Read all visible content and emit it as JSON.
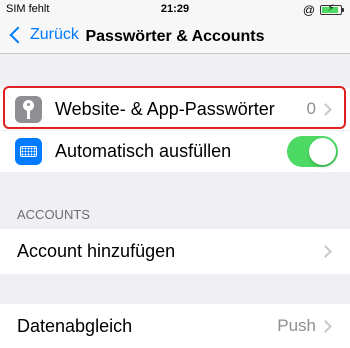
{
  "status_bar": {
    "carrier": "SIM fehlt",
    "time": "21:29",
    "icons": [
      "rotation-lock-icon",
      "battery-icon"
    ],
    "battery_color": "#4cd964",
    "battery_level": 0.9
  },
  "nav": {
    "back_label": "Zurück",
    "title": "Passwörter & Accounts"
  },
  "rows": {
    "passwords": {
      "label": "Website- & App-Passwörter",
      "value": "0",
      "icon": "key-icon"
    },
    "autofill": {
      "label": "Automatisch ausfüllen",
      "toggle_on": true,
      "icon": "keyboard-icon"
    },
    "add_account": {
      "label": "Account hinzufügen"
    },
    "fetch": {
      "label": "Datenabgleich",
      "value": "Push"
    }
  },
  "sections": {
    "accounts_header": "ACCOUNTS"
  },
  "colors": {
    "accent": "#007aff",
    "toggle_on": "#4cd964",
    "highlight": "#e02020"
  }
}
